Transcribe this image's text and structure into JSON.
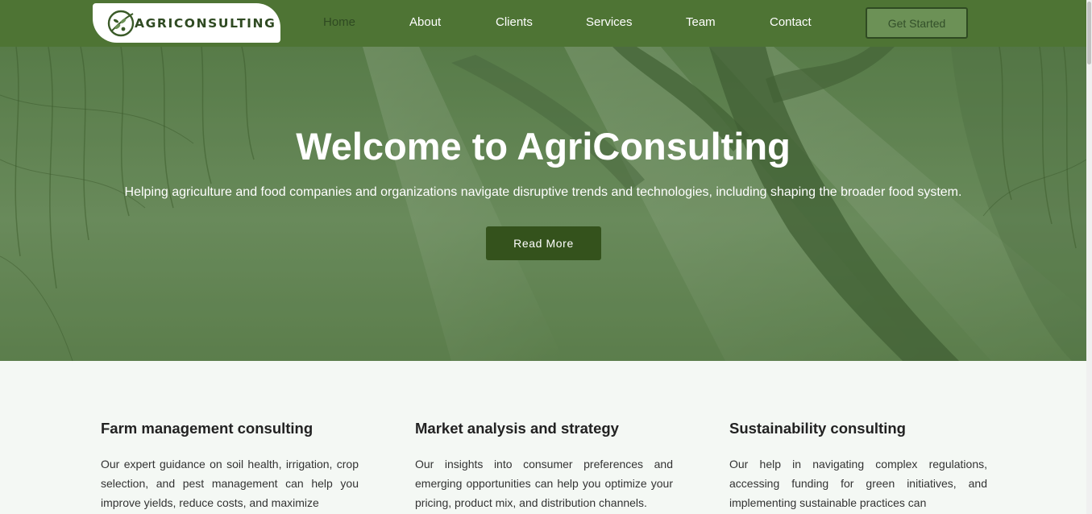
{
  "header": {
    "logo_text": "AGRICONSULTING",
    "nav": [
      {
        "label": "Home",
        "active": true
      },
      {
        "label": "About"
      },
      {
        "label": "Clients"
      },
      {
        "label": "Services"
      },
      {
        "label": "Team"
      },
      {
        "label": "Contact"
      }
    ],
    "cta_label": "Get Started"
  },
  "hero": {
    "title": "Welcome to AgriConsulting",
    "subtitle": "Helping agriculture and food companies and organizations navigate disruptive trends and technologies, including shaping the broader food system.",
    "button_label": "Read More"
  },
  "services": [
    {
      "title": "Farm management consulting",
      "description": "Our expert guidance on soil health, irrigation, crop selection, and pest management can help you improve yields, reduce costs, and maximize"
    },
    {
      "title": "Market analysis and strategy",
      "description": "Our insights into consumer preferences and emerging opportunities can help you optimize your pricing, product mix, and distribution channels."
    },
    {
      "title": "Sustainability consulting",
      "description": "Our help in navigating complex regulations, accessing funding for green initiatives, and implementing sustainable practices can"
    }
  ],
  "colors": {
    "header_bg": "#4e7434",
    "accent_dark": "#34521c",
    "page_bg": "#f4f8f4"
  }
}
